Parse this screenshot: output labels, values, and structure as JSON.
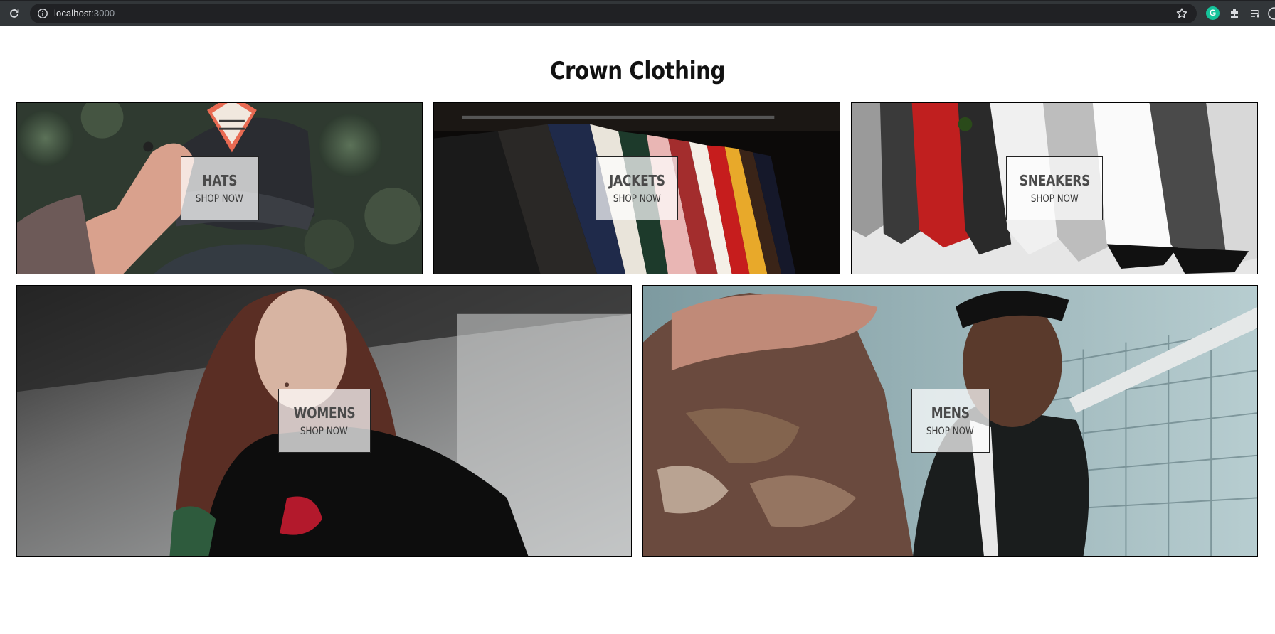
{
  "browser": {
    "url_host": "localhost",
    "url_port": ":3000",
    "extensions": [
      "grammarly-icon",
      "puzzle-icon",
      "media-control-icon"
    ]
  },
  "page": {
    "title": "Crown Clothing"
  },
  "categories": [
    {
      "id": "hats",
      "title": "HATS",
      "subtitle": "SHOP NOW"
    },
    {
      "id": "jackets",
      "title": "JACKETS",
      "subtitle": "SHOP NOW"
    },
    {
      "id": "sneakers",
      "title": "SNEAKERS",
      "subtitle": "SHOP NOW"
    },
    {
      "id": "womens",
      "title": "WOMENS",
      "subtitle": "SHOP NOW"
    },
    {
      "id": "mens",
      "title": "MENS",
      "subtitle": "SHOP NOW"
    }
  ],
  "colors": {
    "browser_bar": "#323639",
    "omnibox": "#202124",
    "content_box_bg": "#ffffffb8",
    "border": "#000000"
  }
}
